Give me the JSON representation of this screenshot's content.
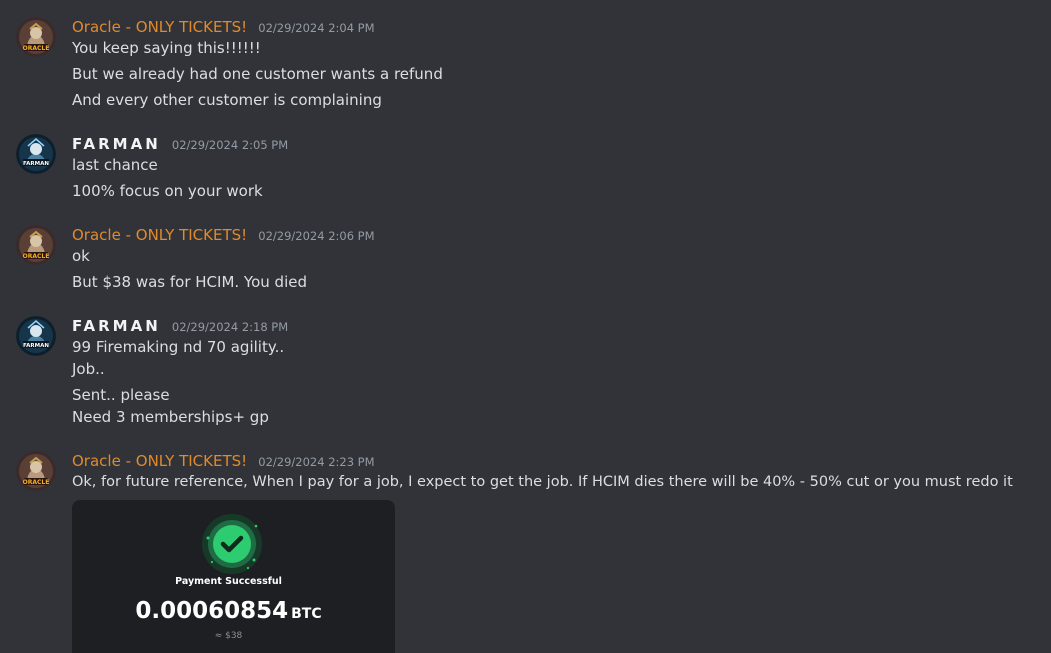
{
  "messages": [
    {
      "author": "Oracle - ONLY TICKETS!",
      "timestamp": "02/29/2024 2:04 PM",
      "lines": [
        "You keep saying this!!!!!!",
        "But we already had one customer wants a refund",
        "And every other customer is complaining"
      ]
    },
    {
      "author": "FARMAN",
      "timestamp": "02/29/2024 2:05 PM",
      "lines": [
        "last chance",
        "100% focus on your work"
      ]
    },
    {
      "author": "Oracle - ONLY TICKETS!",
      "timestamp": "02/29/2024 2:06 PM",
      "lines": [
        "ok",
        "But $38 was for HCIM. You died"
      ]
    },
    {
      "author": "FARMAN",
      "timestamp": "02/29/2024 2:18 PM",
      "lines": [
        "99 Firemaking nd 70 agility..",
        "Job..",
        "Sent.. please",
        "Need 3 memberships+ gp"
      ]
    },
    {
      "author": "Oracle - ONLY TICKETS!",
      "timestamp": "02/29/2024 2:23 PM",
      "lines": [
        "Ok, for future reference, When I pay for a job, I expect to get the job. If HCIM dies there will be 40% - 50% cut or you must redo it"
      ],
      "attachment": {
        "title": "Payment Successful",
        "amount": "0.00060854",
        "currency": "BTC",
        "usd": "≈ $38"
      }
    }
  ],
  "avatars": {
    "oracle_text": "ORACLE",
    "farman_text": "FARMAN"
  },
  "colors": {
    "background": "#313338",
    "oracle_name": "#e08a2c",
    "farman_name": "#f2f3f5",
    "message_text": "#dbdee1",
    "timestamp": "#949ba4",
    "success_green": "#2ecc71"
  }
}
